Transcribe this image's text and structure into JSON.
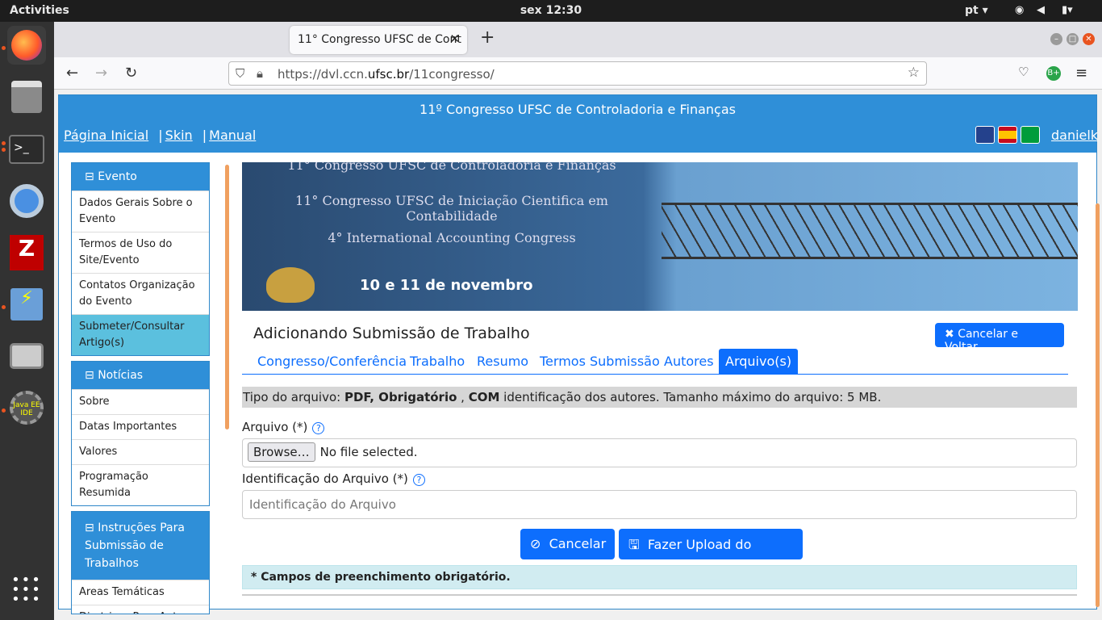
{
  "os": {
    "activities": "Activities",
    "clock": "sex 12:30",
    "lang": "pt ▾"
  },
  "browser": {
    "tab_title": "11° Congresso UFSC de Cont",
    "url_prefix": "https://dvl.ccn.",
    "url_domain": "ufsc.br",
    "url_suffix": "/11congresso/"
  },
  "header": {
    "title": "11º Congresso UFSC de Controladoria e Finanças",
    "home": "Página Inicial",
    "skin": "Skin",
    "manual": "Manual",
    "sep": "|",
    "user": "danielk"
  },
  "sidebar": {
    "evento": {
      "title": "Evento",
      "items": [
        "Dados Gerais Sobre o Evento",
        "Termos de Uso do Site/Evento",
        "Contatos Organização do Evento",
        "Submeter/Consultar Artigo(s)"
      ]
    },
    "noticias": {
      "title": "Notícias",
      "items": [
        "Sobre",
        "Datas Importantes",
        "Valores",
        "Programação Resumida"
      ]
    },
    "instrucoes": {
      "title": "Instruções Para Submissão de Trabalhos",
      "items": [
        "Areas Temáticas",
        "Diretrizes Para Autores"
      ]
    }
  },
  "banner": {
    "line1": "11° Congresso UFSC de Controladoria e Finanças",
    "line2": "11° Congresso UFSC de Iniciação Cientifica em Contabilidade",
    "line3": "4° International Accounting Congress",
    "date": "10 e 11 de novembro"
  },
  "form": {
    "title": "Adicionando Submissão de Trabalho",
    "cancel_back": "Cancelar e Voltar",
    "tabs": [
      "Congresso/Conferência",
      "Trabalho",
      "Resumo",
      "Termos Submissão",
      "Autores",
      "Arquivo(s)"
    ],
    "info_prefix": "Tipo do arquivo: ",
    "info_pdf": "PDF, Obrigatório",
    "info_mid": " , ",
    "info_com": "COM",
    "info_suffix": " identificação dos autores. Tamanho máximo do arquivo: 5 MB.",
    "file_label": "Arquivo (*)",
    "browse": "Browse…",
    "no_file": "No file selected.",
    "id_label": "Identificação do Arquivo (*)",
    "id_placeholder": "Identificação do Arquivo",
    "cancel": "Cancelar",
    "upload": "Fazer Upload do Arquivo",
    "required_note": "* Campos de preenchimento obrigatório."
  }
}
